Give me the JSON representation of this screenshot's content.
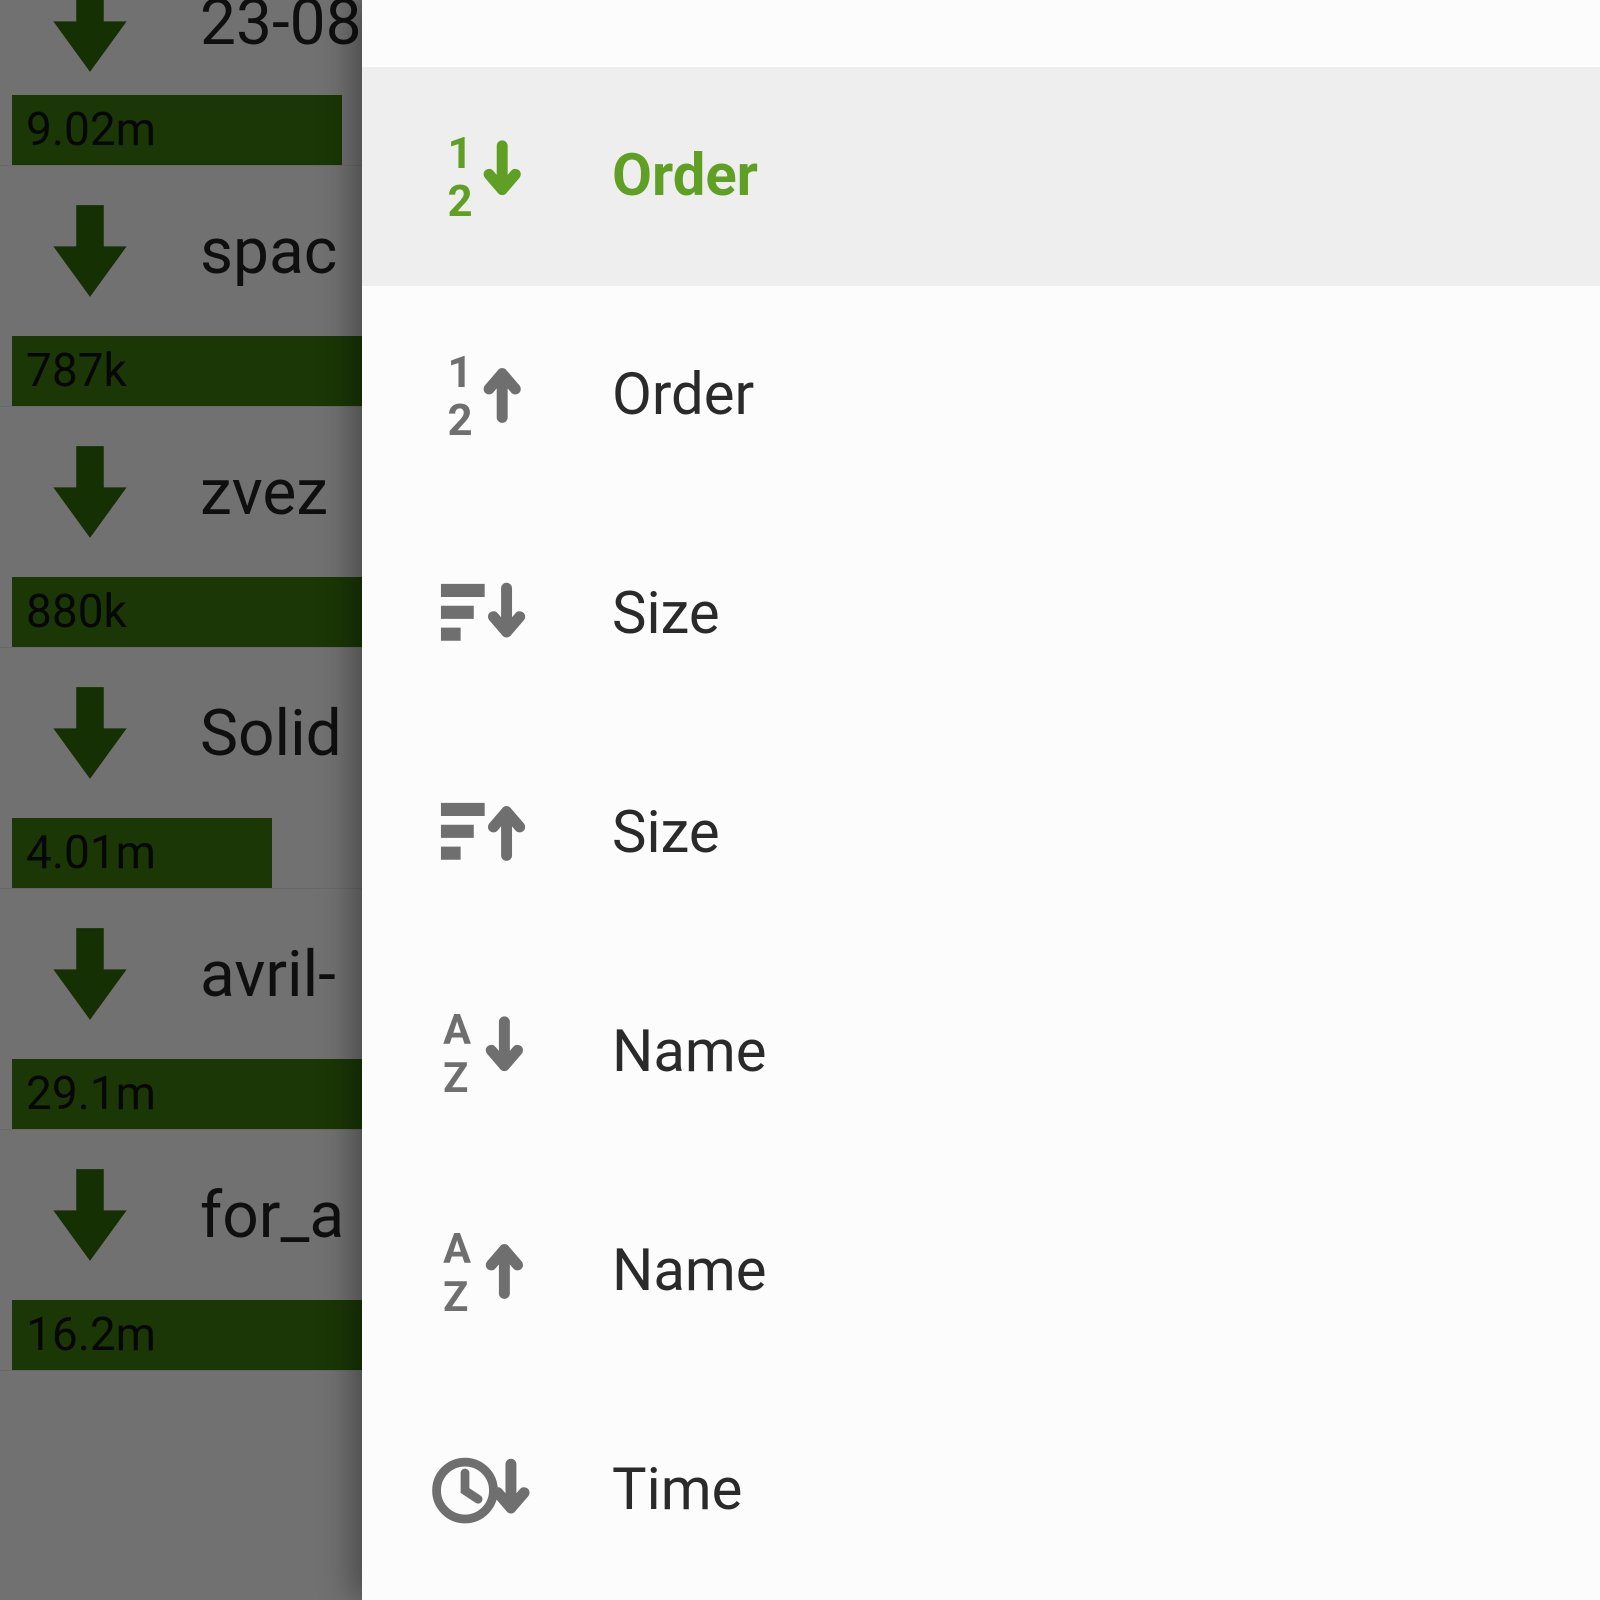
{
  "downloads": [
    {
      "name": "23-08",
      "size": "9.02m"
    },
    {
      "name": "spac",
      "size": "787k"
    },
    {
      "name": "zvez",
      "size": "880k"
    },
    {
      "name": "Solid",
      "size": "4.01m"
    },
    {
      "name": "avril-",
      "size": "29.1m"
    },
    {
      "name": "for_a",
      "size": "16.2m"
    }
  ],
  "sortPanel": {
    "items": [
      {
        "label": "Order",
        "icon": "num-desc",
        "selected": true
      },
      {
        "label": "Order",
        "icon": "num-asc",
        "selected": false
      },
      {
        "label": "Size",
        "icon": "size-desc",
        "selected": false
      },
      {
        "label": "Size",
        "icon": "size-asc",
        "selected": false
      },
      {
        "label": "Name",
        "icon": "name-desc",
        "selected": false
      },
      {
        "label": "Name",
        "icon": "name-asc",
        "selected": false
      },
      {
        "label": "Time",
        "icon": "time-desc",
        "selected": false
      }
    ]
  },
  "colors": {
    "accent": "#5fa024",
    "downloadArrow": "#2f6b08",
    "sizeBar": "#3a7a0c"
  }
}
